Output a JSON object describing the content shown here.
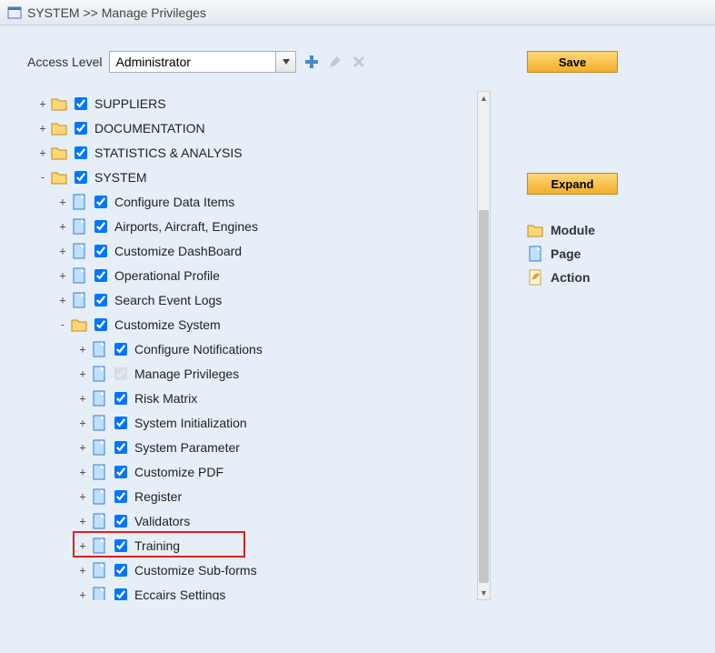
{
  "header": {
    "breadcrumb_root": "SYSTEM",
    "breadcrumb_sep": ">>",
    "breadcrumb_page": "Manage Privileges"
  },
  "toolbar": {
    "access_level_label": "Access Level",
    "access_level_value": "Administrator",
    "save_label": "Save"
  },
  "side": {
    "expand_label": "Expand",
    "legend_module": "Module",
    "legend_page": "Page",
    "legend_action": "Action"
  },
  "tree": [
    {
      "label": "SUPPLIERS",
      "type": "module",
      "toggle": "+",
      "checked": true
    },
    {
      "label": "DOCUMENTATION",
      "type": "module",
      "toggle": "+",
      "checked": true
    },
    {
      "label": "STATISTICS & ANALYSIS",
      "type": "module",
      "toggle": "+",
      "checked": true
    },
    {
      "label": "SYSTEM",
      "type": "module",
      "toggle": "-",
      "checked": true,
      "children": [
        {
          "label": "Configure Data Items",
          "type": "page",
          "toggle": "+",
          "checked": true
        },
        {
          "label": "Airports, Aircraft, Engines",
          "type": "page",
          "toggle": "+",
          "checked": true
        },
        {
          "label": "Customize DashBoard",
          "type": "page",
          "toggle": "+",
          "checked": true
        },
        {
          "label": "Operational Profile",
          "type": "page",
          "toggle": "+",
          "checked": true
        },
        {
          "label": "Search Event Logs",
          "type": "page",
          "toggle": "+",
          "checked": true
        },
        {
          "label": "Customize System",
          "type": "module",
          "toggle": "-",
          "checked": true,
          "children": [
            {
              "label": "Configure Notifications",
              "type": "page",
              "toggle": "+",
              "checked": true
            },
            {
              "label": "Manage Privileges",
              "type": "page",
              "toggle": "+",
              "checked": true,
              "disabled": true
            },
            {
              "label": "Risk Matrix",
              "type": "page",
              "toggle": "+",
              "checked": true
            },
            {
              "label": "System Initialization",
              "type": "page",
              "toggle": "+",
              "checked": true
            },
            {
              "label": "System Parameter",
              "type": "page",
              "toggle": "+",
              "checked": true
            },
            {
              "label": "Customize PDF",
              "type": "page",
              "toggle": "+",
              "checked": true
            },
            {
              "label": "Register",
              "type": "page",
              "toggle": "+",
              "checked": true
            },
            {
              "label": "Validators",
              "type": "page",
              "toggle": "+",
              "checked": true
            },
            {
              "label": "Training",
              "type": "page",
              "toggle": "+",
              "checked": true,
              "highlighted": true
            },
            {
              "label": "Customize Sub-forms",
              "type": "page",
              "toggle": "+",
              "checked": true
            },
            {
              "label": "Eccairs Settings",
              "type": "page",
              "toggle": "+",
              "checked": true
            }
          ]
        }
      ]
    }
  ]
}
